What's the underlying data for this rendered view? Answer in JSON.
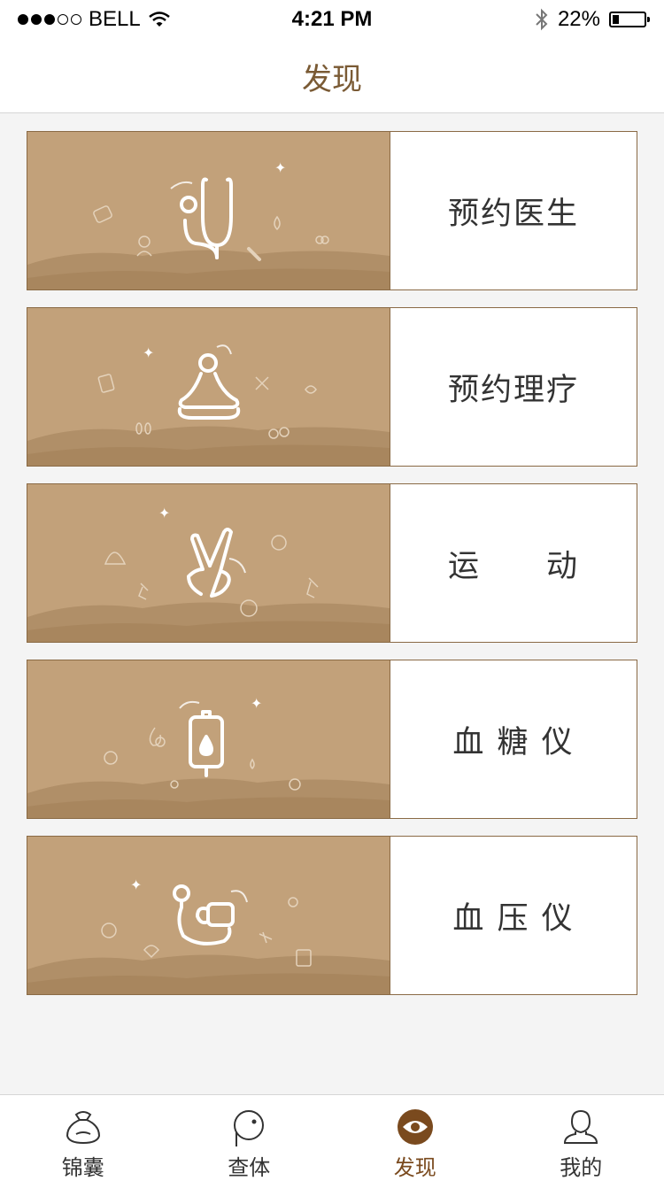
{
  "status_bar": {
    "carrier": "BELL",
    "time": "4:21 PM",
    "battery": "22%",
    "battery_level": 0.22,
    "signal_bars": 3,
    "signal_total": 5
  },
  "nav": {
    "title": "发现"
  },
  "cards": [
    {
      "label": "预约医生",
      "icon": "stethoscope-icon"
    },
    {
      "label": "预约理疗",
      "icon": "meditation-icon"
    },
    {
      "label": "运　　动",
      "icon": "victory-hand-icon"
    },
    {
      "label": "血 糖 仪",
      "icon": "iv-bag-icon"
    },
    {
      "label": "血 压 仪",
      "icon": "blood-pressure-icon"
    }
  ],
  "tabs": [
    {
      "label": "锦囊",
      "icon": "pouch-icon",
      "active": false
    },
    {
      "label": "查体",
      "icon": "checkup-icon",
      "active": false
    },
    {
      "label": "发现",
      "icon": "eye-icon",
      "active": true
    },
    {
      "label": "我的",
      "icon": "person-icon",
      "active": false
    }
  ],
  "colors": {
    "accent": "#7a4a1e",
    "title": "#7a5a34",
    "card_bg": "#c2a17a",
    "card_border": "#8a6a45"
  }
}
